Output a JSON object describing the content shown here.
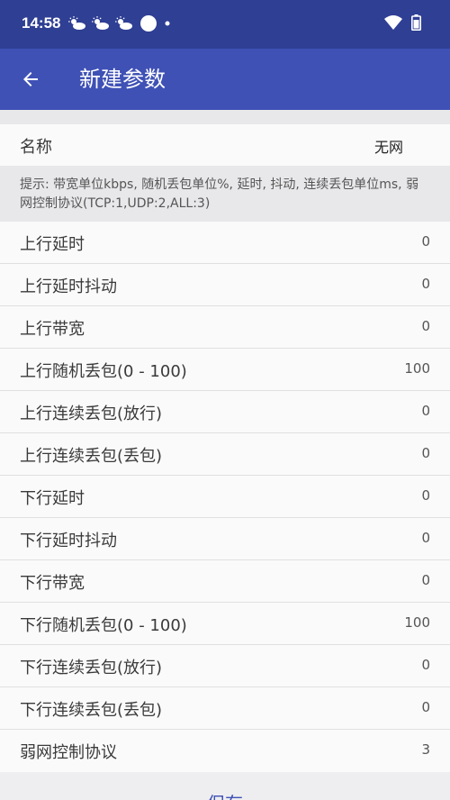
{
  "status": {
    "time": "14:58"
  },
  "appbar": {
    "title": "新建参数"
  },
  "name_row": {
    "label": "名称",
    "value": "无网"
  },
  "hint": "提示: 带宽单位kbps, 随机丢包单位%, 延时, 抖动, 连续丢包单位ms, 弱网控制协议(TCP:1,UDP:2,ALL:3)",
  "params": [
    {
      "label": "上行延时",
      "value": "0"
    },
    {
      "label": "上行延时抖动",
      "value": "0"
    },
    {
      "label": "上行带宽",
      "value": "0"
    },
    {
      "label": "上行随机丢包(0 - 100)",
      "value": "100"
    },
    {
      "label": "上行连续丢包(放行)",
      "value": "0"
    },
    {
      "label": "上行连续丢包(丢包)",
      "value": "0"
    },
    {
      "label": "下行延时",
      "value": "0"
    },
    {
      "label": "下行延时抖动",
      "value": "0"
    },
    {
      "label": "下行带宽",
      "value": "0"
    },
    {
      "label": "下行随机丢包(0 - 100)",
      "value": "100"
    },
    {
      "label": "下行连续丢包(放行)",
      "value": "0"
    },
    {
      "label": "下行连续丢包(丢包)",
      "value": "0"
    },
    {
      "label": "弱网控制协议",
      "value": "3"
    }
  ],
  "save_label": "保存",
  "icons": {
    "status_left": [
      "cloud-sun-icon",
      "cloud-sun-icon",
      "cloud-sun-icon",
      "circle-notification-icon",
      "dot-icon"
    ],
    "status_right": [
      "wifi-icon",
      "battery-icon"
    ],
    "back": "arrow-left-icon"
  },
  "colors": {
    "status_bar": "#2f3f94",
    "app_bar": "#3f51b5",
    "accent": "#3f51b5"
  }
}
